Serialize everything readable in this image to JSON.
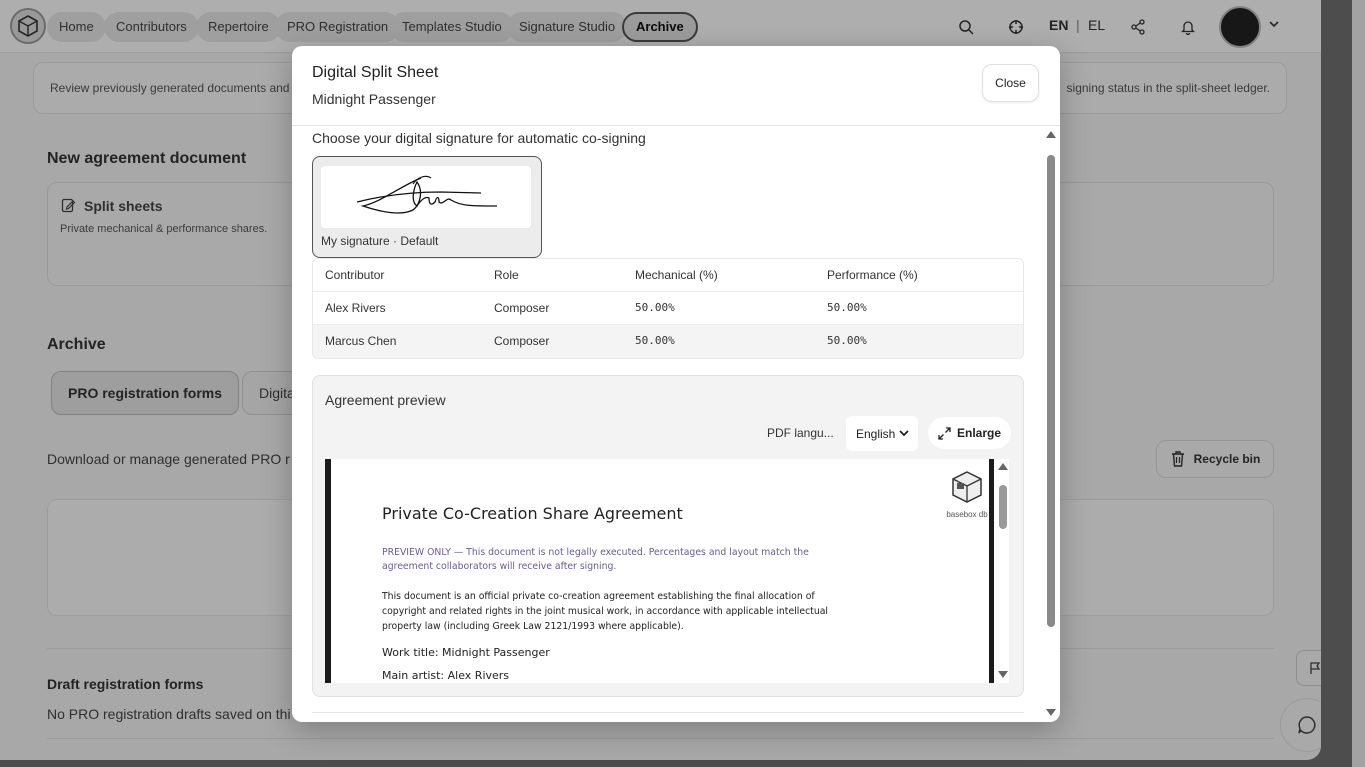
{
  "nav": {
    "items": [
      "Home",
      "Contributors",
      "Repertoire",
      "PRO Registration",
      "Templates Studio",
      "Signature Studio",
      "Archive"
    ],
    "active": "Archive",
    "lang_en": "EN",
    "lang_sep": "|",
    "lang_el": "EL"
  },
  "banner": {
    "left_text": "Review previously generated documents and",
    "right_text": "signing status in the split-sheet ledger."
  },
  "new_agreement": {
    "title": "New agreement document",
    "card_title": "Split sheets",
    "card_desc": "Private mechanical & performance shares."
  },
  "archive": {
    "title": "Archive",
    "tabs": [
      "PRO registration forms",
      "Digita"
    ],
    "description": "Download or manage generated PRO r",
    "recycle_label": "Recycle bin",
    "draft_title": "Draft registration forms",
    "draft_text": "No PRO registration drafts saved on thi"
  },
  "modal": {
    "title": "Digital Split Sheet",
    "subtitle": "Midnight Passenger",
    "close_label": "Close",
    "choose_label": "Choose your digital signature for automatic co-signing",
    "signature_name": "My signature · Default",
    "table": {
      "headers": [
        "Contributor",
        "Role",
        "Mechanical (%)",
        "Performance (%)"
      ],
      "rows": [
        [
          "Alex Rivers",
          "Composer",
          "50.00%",
          "50.00%"
        ],
        [
          "Marcus Chen",
          "Composer",
          "50.00%",
          "50.00%"
        ]
      ]
    },
    "preview": {
      "title": "Agreement preview",
      "pdf_lang_label": "PDF langu...",
      "pdf_lang_value": "English",
      "enlarge_label": "Enlarge",
      "doc": {
        "logo_caption": "basebox db",
        "title": "Private Co-Creation Share Agreement",
        "preview_note": "PREVIEW ONLY — This document is not legally executed. Percentages and layout match the agreement collaborators will receive after signing.",
        "body": "This document is an official private co-creation agreement establishing the final allocation of copyright and related rights in the joint musical work, in accordance with applicable intellectual property law (including Greek Law 2121/1993 where applicable).",
        "work_title": "Work title: Midnight Passenger",
        "main_artist": "Main artist: Alex Rivers"
      }
    }
  }
}
